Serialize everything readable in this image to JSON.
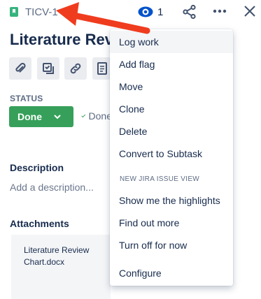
{
  "header": {
    "issue_key": "TICV-1",
    "watch_count": "1",
    "icons": [
      "story-icon",
      "eye-icon",
      "share-icon",
      "more-icon",
      "close-icon"
    ]
  },
  "issue": {
    "title": "Literature Review Chart"
  },
  "toolbar": {
    "buttons": [
      "attach-icon",
      "subtask-icon",
      "link-icon",
      "page-icon"
    ]
  },
  "status": {
    "label": "STATUS",
    "value": "Done",
    "resolution": "Done",
    "color": "#36a05a"
  },
  "description": {
    "heading": "Description",
    "placeholder": "Add a description..."
  },
  "attachments": {
    "heading": "Attachments",
    "files": [
      "Literature Review Chart.docx"
    ]
  },
  "menu": {
    "items": [
      "Log work",
      "Add flag",
      "Move",
      "Clone",
      "Delete",
      "Convert to Subtask"
    ],
    "section_label": "NEW JIRA ISSUE VIEW",
    "section_items": [
      "Show me the highlights",
      "Find out more",
      "Turn off for now"
    ],
    "footer_item": "Configure"
  },
  "colors": {
    "accent": "#0052cc",
    "annotation": "#f03c1e",
    "story": "#36b37e"
  }
}
